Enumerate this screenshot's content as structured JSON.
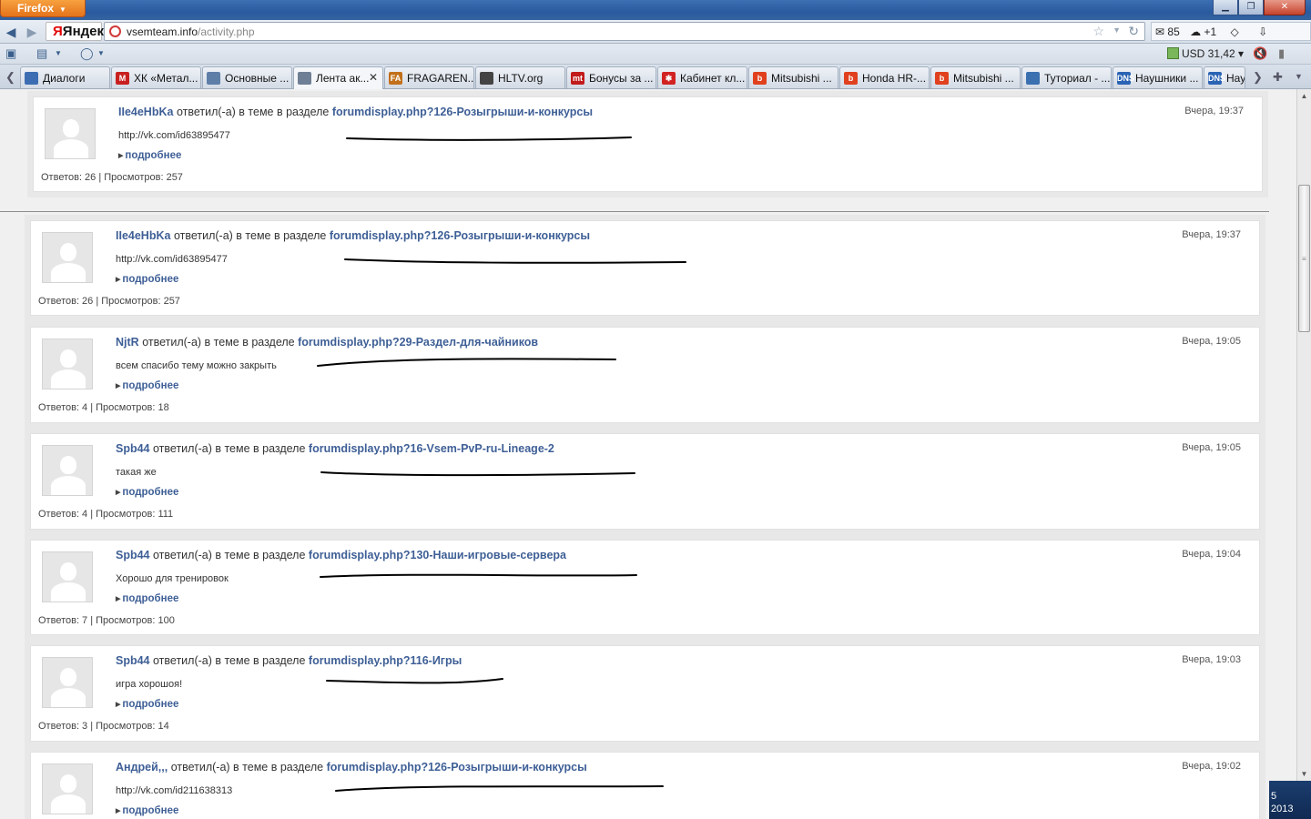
{
  "browser": {
    "app_button": "Firefox",
    "search_brand": "Яндекс",
    "url_host": "vsemteam.info",
    "url_path": "/activity.php",
    "mail_count": "85",
    "weather_delta": "+1",
    "currency": "USD 31,42"
  },
  "tabs": [
    {
      "label": "Диалоги",
      "fav": "",
      "fav_color": "#3c6db2"
    },
    {
      "label": "ХК «Метал...",
      "fav": "M",
      "fav_color": "#c81f1f"
    },
    {
      "label": "Основные ...",
      "fav": "",
      "fav_color": "#5e7ea8"
    },
    {
      "label": "Лента ак...",
      "fav": "",
      "fav_color": "#6f7f95",
      "active": true
    },
    {
      "label": "FRAGAREN...",
      "fav": "FA",
      "fav_color": "#c2701b"
    },
    {
      "label": "HLTV.org",
      "fav": "",
      "fav_color": "#444444"
    },
    {
      "label": "Бонусы за ...",
      "fav": "mt",
      "fav_color": "#c21b1b"
    },
    {
      "label": "Кабинет кл...",
      "fav": "✱",
      "fav_color": "#d22222"
    },
    {
      "label": "Mitsubishi ...",
      "fav": "b",
      "fav_color": "#e0401d"
    },
    {
      "label": "Honda HR-...",
      "fav": "b",
      "fav_color": "#e0401d"
    },
    {
      "label": "Mitsubishi ...",
      "fav": "b",
      "fav_color": "#e0401d"
    },
    {
      "label": "Туториал - ...",
      "fav": "",
      "fav_color": "#3a6fb0"
    },
    {
      "label": "Наушники ...",
      "fav": "DNS",
      "fav_color": "#2a63b3"
    },
    {
      "label": "Нау",
      "fav": "DNS",
      "fav_color": "#2a63b3"
    }
  ],
  "feed": {
    "action_text": "ответил(-а) в теме в разделе",
    "more_label": "подробнее",
    "items": [
      {
        "user": "IIe4eHbKa",
        "forum": "forumdisplay.php?126-Розыгрыши-и-конкурсы",
        "date": "Вчера, 19:37",
        "message": "http://vk.com/id63895477",
        "stats": "Ответов: 26 | Просмотров: 257"
      },
      {
        "user": "IIe4eHbKa",
        "forum": "forumdisplay.php?126-Розыгрыши-и-конкурсы",
        "date": "Вчера, 19:37",
        "message": "http://vk.com/id63895477",
        "stats": "Ответов: 26 | Просмотров: 257"
      },
      {
        "user": "NjtR",
        "forum": "forumdisplay.php?29-Раздел-для-чайников",
        "date": "Вчера, 19:05",
        "message": "всем спасибо тему можно закрыть",
        "stats": "Ответов: 4 | Просмотров: 18"
      },
      {
        "user": "Spb44",
        "forum": "forumdisplay.php?16-Vsem-PvP-ru-Lineage-2",
        "date": "Вчера, 19:05",
        "message": "такая же",
        "stats": "Ответов: 4 | Просмотров: 111"
      },
      {
        "user": "Spb44",
        "forum": "forumdisplay.php?130-Наши-игровые-сервера",
        "date": "Вчера, 19:04",
        "message": "Хорошо для тренировок",
        "stats": "Ответов: 7 | Просмотров: 100"
      },
      {
        "user": "Spb44",
        "forum": "forumdisplay.php?116-Игры",
        "date": "Вчера, 19:03",
        "message": "игра хорошоя!",
        "stats": "Ответов: 3 | Просмотров: 14"
      },
      {
        "user": "Андрей,,,",
        "forum": "forumdisplay.php?126-Розыгрыши-и-конкурсы",
        "date": "Вчера, 19:02",
        "message": "http://vk.com/id211638313",
        "stats": ""
      }
    ]
  },
  "taskbar_year": "2013",
  "taskbar_digit": "5"
}
